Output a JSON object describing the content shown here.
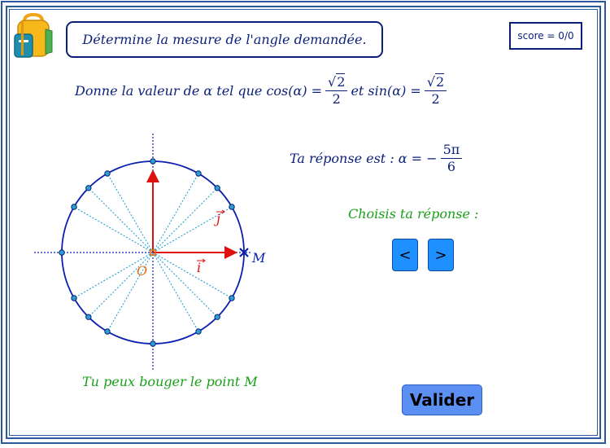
{
  "instruction": "Détermine la mesure de l'angle demandée.",
  "score": "score = 0/0",
  "question": {
    "prefix": "Donne la valeur de α tel que cos(α) =",
    "cos_num": "√2",
    "cos_num_root": "2",
    "cos_den": "2",
    "middle": "et sin(α) =",
    "sin_num_root": "2",
    "sin_den": "2"
  },
  "answer": {
    "prefix": "Ta réponse est :  α = −",
    "num": "5π",
    "den": "6"
  },
  "choose_label": "Choisis ta réponse :",
  "prev_button": "<",
  "next_button": ">",
  "hint": "Tu peux bouger le point M",
  "validate_button": "Valider",
  "circle": {
    "origin_label": "O",
    "i_label": "i",
    "j_label": "j",
    "point_label": "M",
    "tick_angles_deg": [
      0,
      30,
      45,
      60,
      90,
      120,
      135,
      150,
      180,
      210,
      225,
      240,
      270,
      300,
      315,
      330
    ]
  },
  "colors": {
    "frame": "#2a5a9a",
    "text_blue": "#0a1f7a",
    "text_green": "#19a019",
    "vector_red": "#e01010",
    "circle_blue": "#0a1fb0",
    "button_blue": "#1e90ff",
    "validate_blue": "#5b8ff2"
  }
}
